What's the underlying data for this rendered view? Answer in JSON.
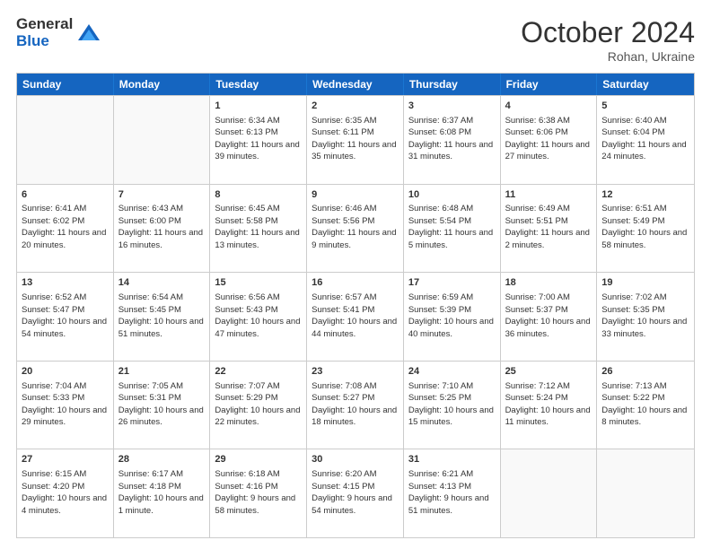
{
  "logo": {
    "general": "General",
    "blue": "Blue"
  },
  "header": {
    "month_year": "October 2024",
    "location": "Rohan, Ukraine"
  },
  "days_of_week": [
    "Sunday",
    "Monday",
    "Tuesday",
    "Wednesday",
    "Thursday",
    "Friday",
    "Saturday"
  ],
  "weeks": [
    [
      {
        "day": "",
        "sunrise": "",
        "sunset": "",
        "daylight": "",
        "empty": true
      },
      {
        "day": "",
        "sunrise": "",
        "sunset": "",
        "daylight": "",
        "empty": true
      },
      {
        "day": "1",
        "sunrise": "Sunrise: 6:34 AM",
        "sunset": "Sunset: 6:13 PM",
        "daylight": "Daylight: 11 hours and 39 minutes."
      },
      {
        "day": "2",
        "sunrise": "Sunrise: 6:35 AM",
        "sunset": "Sunset: 6:11 PM",
        "daylight": "Daylight: 11 hours and 35 minutes."
      },
      {
        "day": "3",
        "sunrise": "Sunrise: 6:37 AM",
        "sunset": "Sunset: 6:08 PM",
        "daylight": "Daylight: 11 hours and 31 minutes."
      },
      {
        "day": "4",
        "sunrise": "Sunrise: 6:38 AM",
        "sunset": "Sunset: 6:06 PM",
        "daylight": "Daylight: 11 hours and 27 minutes."
      },
      {
        "day": "5",
        "sunrise": "Sunrise: 6:40 AM",
        "sunset": "Sunset: 6:04 PM",
        "daylight": "Daylight: 11 hours and 24 minutes."
      }
    ],
    [
      {
        "day": "6",
        "sunrise": "Sunrise: 6:41 AM",
        "sunset": "Sunset: 6:02 PM",
        "daylight": "Daylight: 11 hours and 20 minutes."
      },
      {
        "day": "7",
        "sunrise": "Sunrise: 6:43 AM",
        "sunset": "Sunset: 6:00 PM",
        "daylight": "Daylight: 11 hours and 16 minutes."
      },
      {
        "day": "8",
        "sunrise": "Sunrise: 6:45 AM",
        "sunset": "Sunset: 5:58 PM",
        "daylight": "Daylight: 11 hours and 13 minutes."
      },
      {
        "day": "9",
        "sunrise": "Sunrise: 6:46 AM",
        "sunset": "Sunset: 5:56 PM",
        "daylight": "Daylight: 11 hours and 9 minutes."
      },
      {
        "day": "10",
        "sunrise": "Sunrise: 6:48 AM",
        "sunset": "Sunset: 5:54 PM",
        "daylight": "Daylight: 11 hours and 5 minutes."
      },
      {
        "day": "11",
        "sunrise": "Sunrise: 6:49 AM",
        "sunset": "Sunset: 5:51 PM",
        "daylight": "Daylight: 11 hours and 2 minutes."
      },
      {
        "day": "12",
        "sunrise": "Sunrise: 6:51 AM",
        "sunset": "Sunset: 5:49 PM",
        "daylight": "Daylight: 10 hours and 58 minutes."
      }
    ],
    [
      {
        "day": "13",
        "sunrise": "Sunrise: 6:52 AM",
        "sunset": "Sunset: 5:47 PM",
        "daylight": "Daylight: 10 hours and 54 minutes."
      },
      {
        "day": "14",
        "sunrise": "Sunrise: 6:54 AM",
        "sunset": "Sunset: 5:45 PM",
        "daylight": "Daylight: 10 hours and 51 minutes."
      },
      {
        "day": "15",
        "sunrise": "Sunrise: 6:56 AM",
        "sunset": "Sunset: 5:43 PM",
        "daylight": "Daylight: 10 hours and 47 minutes."
      },
      {
        "day": "16",
        "sunrise": "Sunrise: 6:57 AM",
        "sunset": "Sunset: 5:41 PM",
        "daylight": "Daylight: 10 hours and 44 minutes."
      },
      {
        "day": "17",
        "sunrise": "Sunrise: 6:59 AM",
        "sunset": "Sunset: 5:39 PM",
        "daylight": "Daylight: 10 hours and 40 minutes."
      },
      {
        "day": "18",
        "sunrise": "Sunrise: 7:00 AM",
        "sunset": "Sunset: 5:37 PM",
        "daylight": "Daylight: 10 hours and 36 minutes."
      },
      {
        "day": "19",
        "sunrise": "Sunrise: 7:02 AM",
        "sunset": "Sunset: 5:35 PM",
        "daylight": "Daylight: 10 hours and 33 minutes."
      }
    ],
    [
      {
        "day": "20",
        "sunrise": "Sunrise: 7:04 AM",
        "sunset": "Sunset: 5:33 PM",
        "daylight": "Daylight: 10 hours and 29 minutes."
      },
      {
        "day": "21",
        "sunrise": "Sunrise: 7:05 AM",
        "sunset": "Sunset: 5:31 PM",
        "daylight": "Daylight: 10 hours and 26 minutes."
      },
      {
        "day": "22",
        "sunrise": "Sunrise: 7:07 AM",
        "sunset": "Sunset: 5:29 PM",
        "daylight": "Daylight: 10 hours and 22 minutes."
      },
      {
        "day": "23",
        "sunrise": "Sunrise: 7:08 AM",
        "sunset": "Sunset: 5:27 PM",
        "daylight": "Daylight: 10 hours and 18 minutes."
      },
      {
        "day": "24",
        "sunrise": "Sunrise: 7:10 AM",
        "sunset": "Sunset: 5:25 PM",
        "daylight": "Daylight: 10 hours and 15 minutes."
      },
      {
        "day": "25",
        "sunrise": "Sunrise: 7:12 AM",
        "sunset": "Sunset: 5:24 PM",
        "daylight": "Daylight: 10 hours and 11 minutes."
      },
      {
        "day": "26",
        "sunrise": "Sunrise: 7:13 AM",
        "sunset": "Sunset: 5:22 PM",
        "daylight": "Daylight: 10 hours and 8 minutes."
      }
    ],
    [
      {
        "day": "27",
        "sunrise": "Sunrise: 6:15 AM",
        "sunset": "Sunset: 4:20 PM",
        "daylight": "Daylight: 10 hours and 4 minutes."
      },
      {
        "day": "28",
        "sunrise": "Sunrise: 6:17 AM",
        "sunset": "Sunset: 4:18 PM",
        "daylight": "Daylight: 10 hours and 1 minute."
      },
      {
        "day": "29",
        "sunrise": "Sunrise: 6:18 AM",
        "sunset": "Sunset: 4:16 PM",
        "daylight": "Daylight: 9 hours and 58 minutes."
      },
      {
        "day": "30",
        "sunrise": "Sunrise: 6:20 AM",
        "sunset": "Sunset: 4:15 PM",
        "daylight": "Daylight: 9 hours and 54 minutes."
      },
      {
        "day": "31",
        "sunrise": "Sunrise: 6:21 AM",
        "sunset": "Sunset: 4:13 PM",
        "daylight": "Daylight: 9 hours and 51 minutes."
      },
      {
        "day": "",
        "sunrise": "",
        "sunset": "",
        "daylight": "",
        "empty": true
      },
      {
        "day": "",
        "sunrise": "",
        "sunset": "",
        "daylight": "",
        "empty": true
      }
    ]
  ]
}
